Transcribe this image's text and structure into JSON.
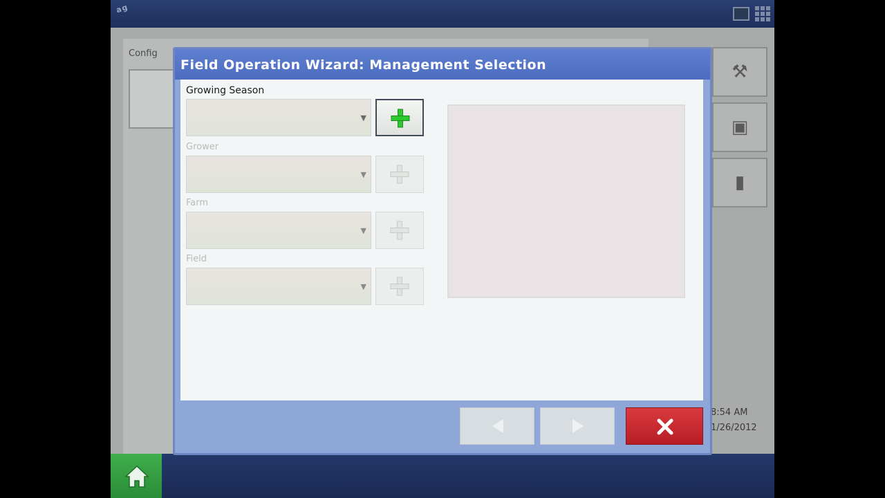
{
  "background": {
    "logo_text": "ag",
    "config_label": "Config",
    "clock_time": "8:54 AM",
    "clock_date": "1/26/2012"
  },
  "dialog": {
    "title": "Field Operation Wizard: Management Selection",
    "fields": [
      {
        "label": "Growing Season",
        "value": "",
        "enabled": true
      },
      {
        "label": "Grower",
        "value": "",
        "enabled": false
      },
      {
        "label": "Farm",
        "value": "",
        "enabled": false
      },
      {
        "label": "Field",
        "value": "",
        "enabled": false
      }
    ]
  },
  "icons": {
    "add": "plus-icon",
    "dropdown": "chevron-down-icon",
    "back": "arrow-left-icon",
    "next": "arrow-right-icon",
    "cancel": "close-icon",
    "home": "home-icon"
  },
  "colors": {
    "title_bar": "#5670c8",
    "add_active": "#2ec92e",
    "cancel": "#c92a30",
    "home": "#35a342"
  }
}
